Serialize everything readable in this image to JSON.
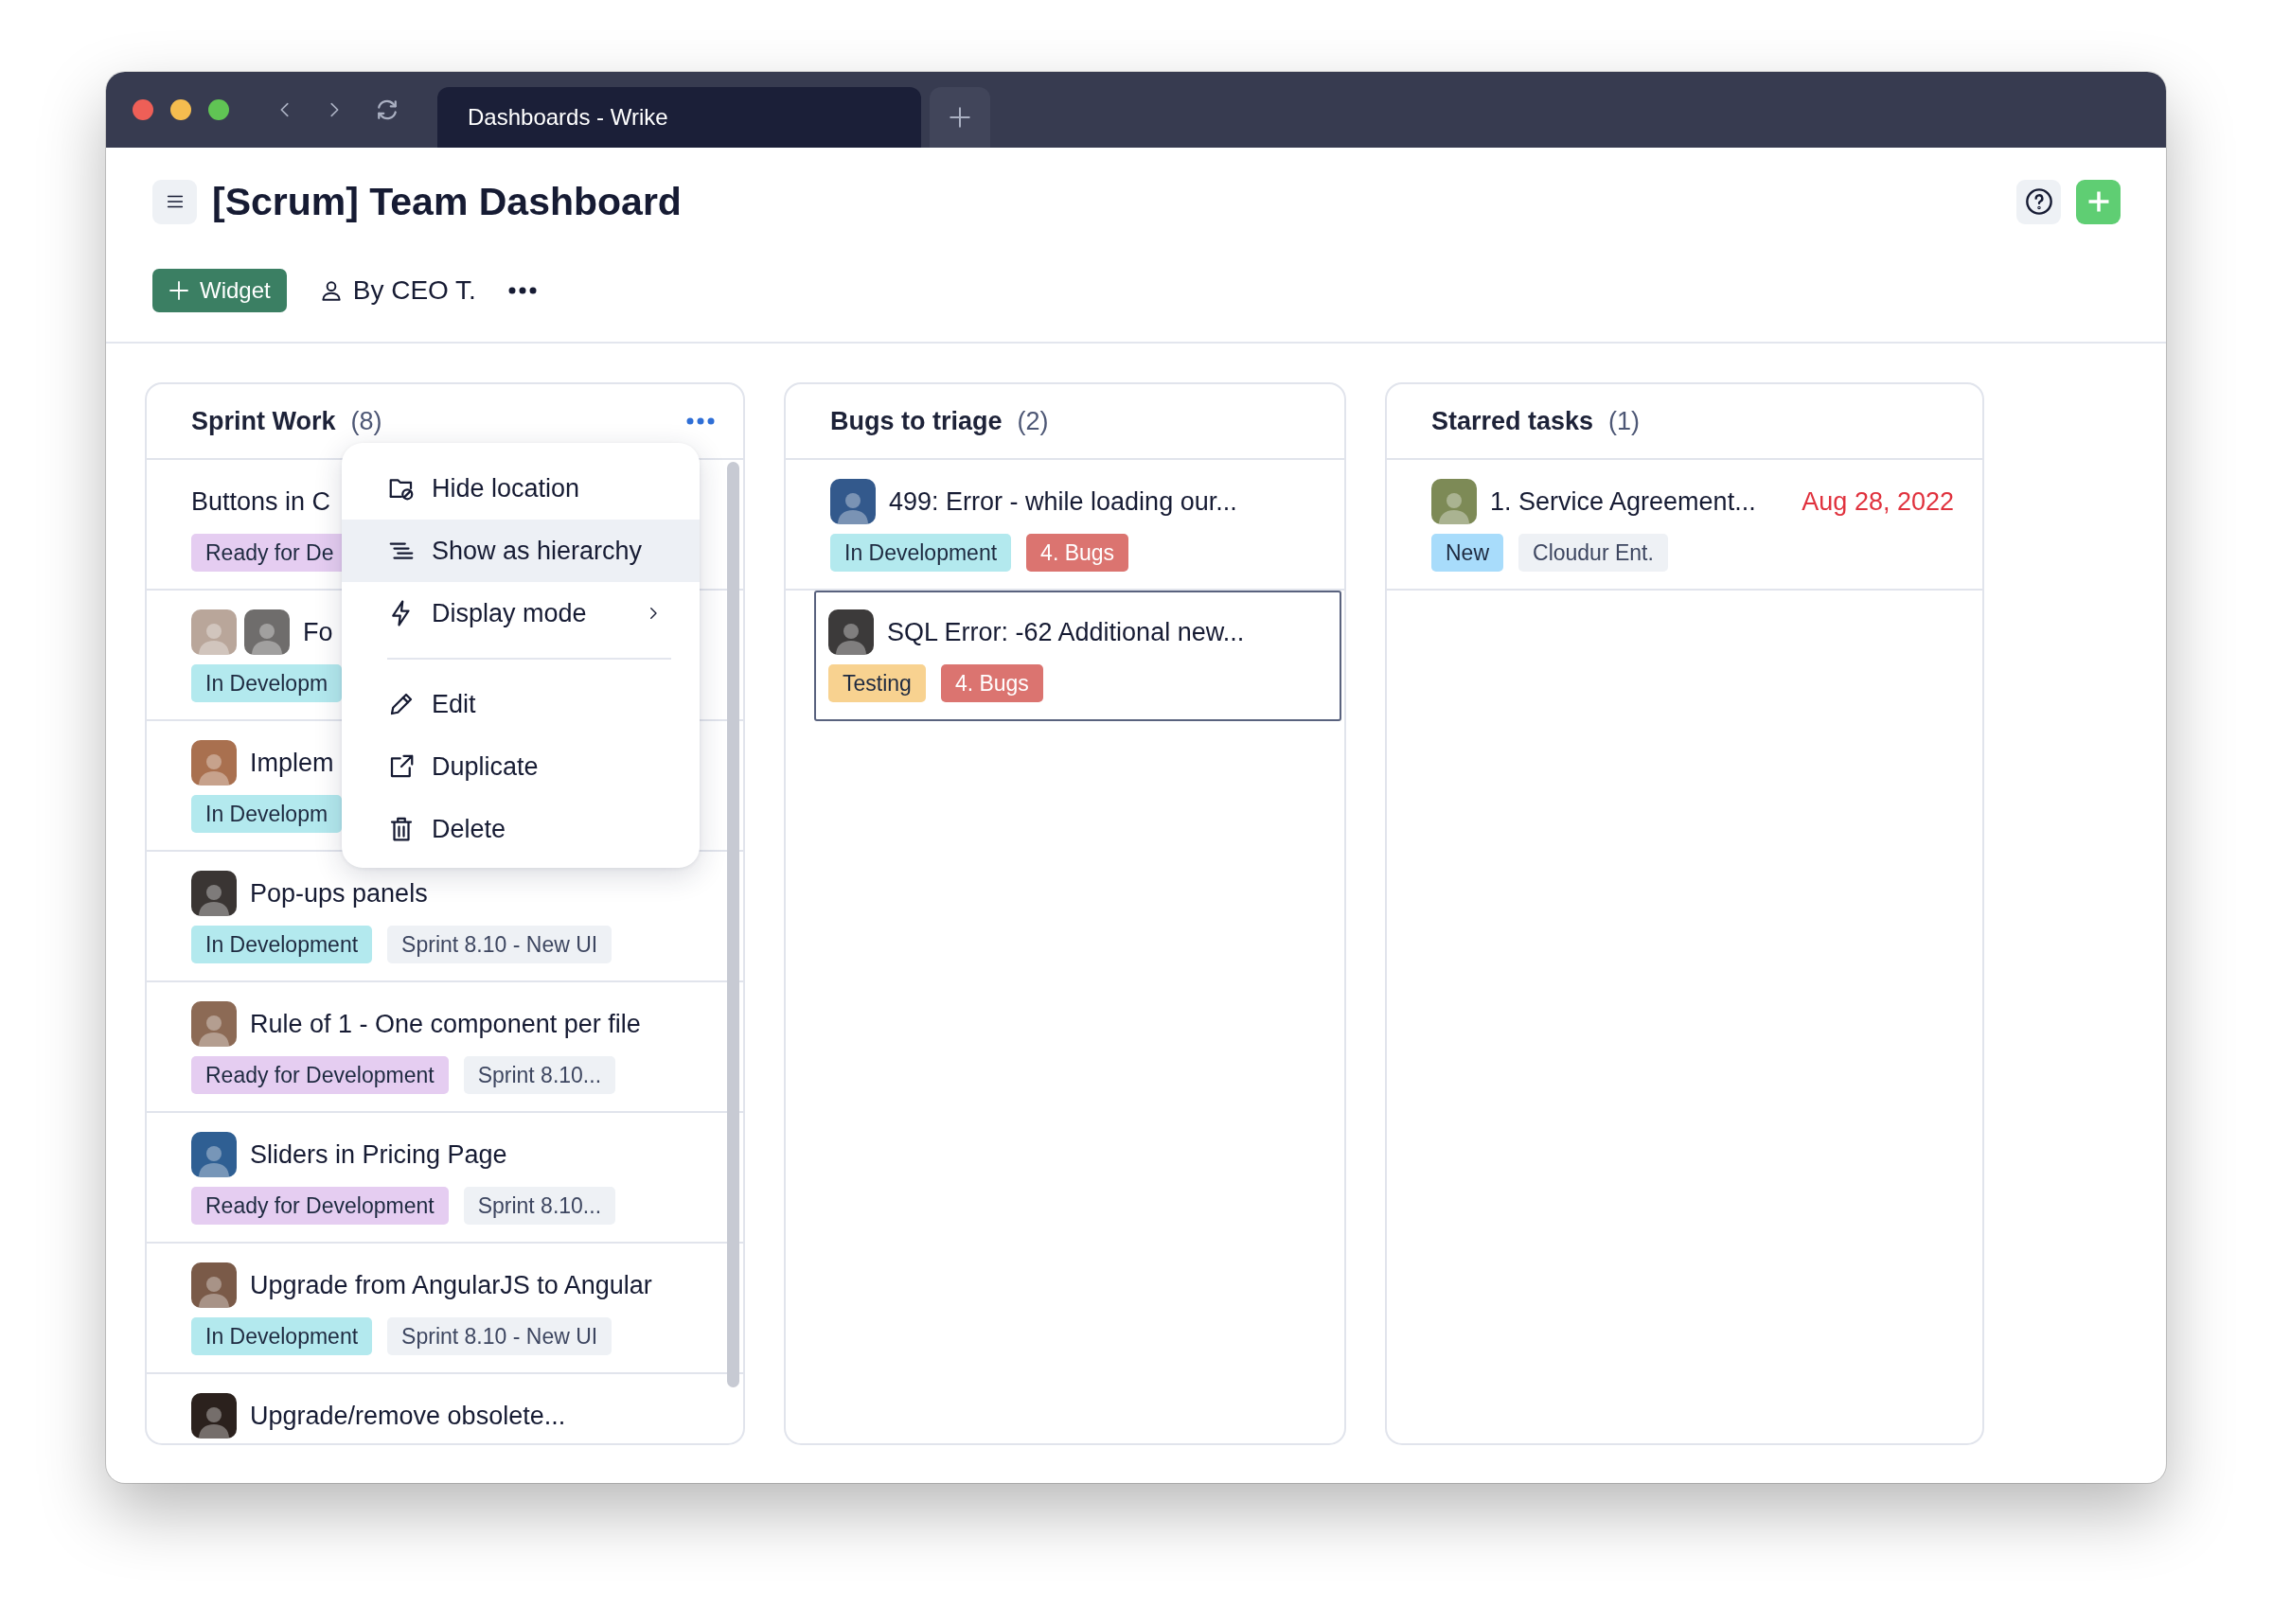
{
  "browser": {
    "tab_title": "Dashboards - Wrike"
  },
  "dashboard": {
    "title": "[Scrum] Team Dashboard",
    "add_widget": "Widget",
    "owner": "By CEO T."
  },
  "widgets": [
    {
      "title": "Sprint Work",
      "count": "(8)",
      "menu_open": true,
      "scrollable": true,
      "rows": [
        {
          "title": "Buttons in C",
          "selected": false,
          "tags": [
            {
              "label": "Ready for De",
              "color": "#e5cdf1"
            }
          ]
        },
        {
          "title": "Fo",
          "selected": false,
          "avatars": [
            {
              "color": "#b9a69a"
            },
            {
              "color": "#6f6d6c"
            }
          ],
          "tags": [
            {
              "label": "In Developm",
              "color": "#b3e9ee"
            }
          ]
        },
        {
          "title": "Implem",
          "selected": false,
          "avatars": [
            {
              "color": "#a9704f"
            }
          ],
          "tags": [
            {
              "label": "In Developm",
              "color": "#b3e9ee"
            }
          ]
        },
        {
          "title": "Pop-ups panels",
          "selected": false,
          "avatars": [
            {
              "color": "#3a3533"
            }
          ],
          "tags": [
            {
              "label": "In Development",
              "color": "#b3e9ee"
            },
            {
              "label": "Sprint 8.10 - New UI",
              "color": "#eef1f5"
            }
          ]
        },
        {
          "title": "Rule of 1 - One component per file",
          "selected": false,
          "avatars": [
            {
              "color": "#8c6a55"
            }
          ],
          "tags": [
            {
              "label": "Ready for Development",
              "color": "#e5cdf1"
            },
            {
              "label": "Sprint 8.10...",
              "color": "#eef1f5"
            }
          ]
        },
        {
          "title": "Sliders in Pricing Page",
          "selected": false,
          "avatars": [
            {
              "color": "#2f5f93"
            }
          ],
          "tags": [
            {
              "label": "Ready for Development",
              "color": "#e5cdf1"
            },
            {
              "label": "Sprint 8.10...",
              "color": "#eef1f5"
            }
          ]
        },
        {
          "title": "Upgrade from AngularJS to Angular",
          "selected": false,
          "avatars": [
            {
              "color": "#7a5a48"
            }
          ],
          "tags": [
            {
              "label": "In Development",
              "color": "#b3e9ee"
            },
            {
              "label": "Sprint 8.10 - New UI",
              "color": "#eef1f5"
            }
          ]
        },
        {
          "title": "Upgrade/remove obsolete...",
          "selected": false,
          "avatars": [
            {
              "color": "#2b211d"
            }
          ]
        }
      ]
    },
    {
      "title": "Bugs to triage",
      "count": "(2)",
      "menu_open": false,
      "scrollable": false,
      "rows": [
        {
          "title": "499: Error - while loading our...",
          "selected": false,
          "avatars": [
            {
              "color": "#33598c"
            }
          ],
          "tags": [
            {
              "label": "In Development",
              "color": "#b3e9ee"
            },
            {
              "label": "4. Bugs",
              "color": "#db7470"
            }
          ]
        },
        {
          "title": "SQL Error: -62 Additional new...",
          "selected": true,
          "avatars": [
            {
              "color": "#3c3a3a"
            }
          ],
          "tags": [
            {
              "label": "Testing",
              "color": "#f8d290"
            },
            {
              "label": "4. Bugs",
              "color": "#db7470"
            }
          ]
        }
      ]
    },
    {
      "title": "Starred tasks",
      "count": "(1)",
      "menu_open": false,
      "scrollable": false,
      "rows": [
        {
          "title": "1. Service Agreement...",
          "due": "Aug 28, 2022",
          "selected": false,
          "avatars": [
            {
              "color": "#7d8a56"
            }
          ],
          "tags": [
            {
              "label": "New",
              "color": "#a8dcfb"
            },
            {
              "label": "Cloudur Ent.",
              "color": "#eef1f5"
            }
          ]
        }
      ]
    }
  ],
  "widget_menu": {
    "items": [
      {
        "label": "Hide location",
        "selected": false,
        "submenu": false,
        "separator_before": false
      },
      {
        "label": "Show as hierarchy",
        "selected": true,
        "submenu": false,
        "separator_before": false
      },
      {
        "label": "Display mode",
        "selected": false,
        "submenu": true,
        "separator_before": false
      },
      {
        "label": "Edit",
        "selected": false,
        "submenu": false,
        "separator_before": true
      },
      {
        "label": "Duplicate",
        "selected": false,
        "submenu": false,
        "separator_before": false
      },
      {
        "label": "Delete",
        "selected": false,
        "submenu": false,
        "separator_before": false
      }
    ]
  }
}
